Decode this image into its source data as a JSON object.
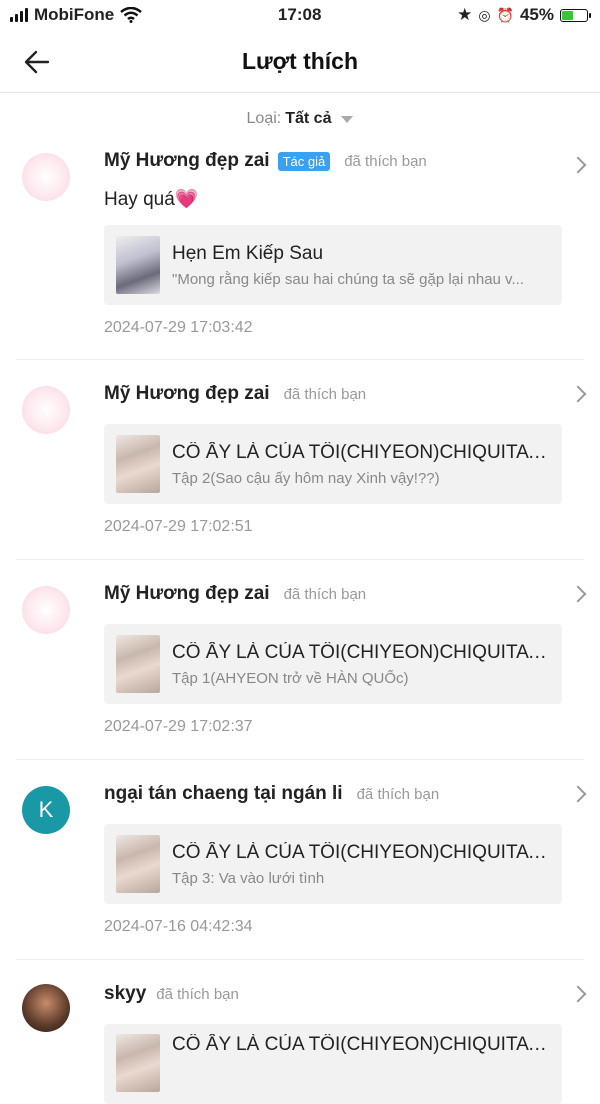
{
  "status": {
    "carrier": "MobiFone",
    "time": "17:08",
    "battery": "45%"
  },
  "header": {
    "title": "Lượt thích"
  },
  "filter": {
    "label": "Loại:",
    "value": "Tất cả"
  },
  "items": [
    {
      "name": "Mỹ Hương đẹp zai",
      "badge": "Tác giả",
      "action": "đã thích bạn",
      "comment": "Hay quá💗",
      "card_title": "Hẹn Em Kiếp Sau",
      "card_sub": "\"Mong rằng kiếp sau hai chúng ta sẽ gặp lại nhau v...",
      "time": "2024-07-29 17:03:42"
    },
    {
      "name": "Mỹ Hương đẹp zai",
      "action": "đã thích bạn",
      "card_title": "CÔ ẤY LÀ CỦA TÔI(CHIYEON)CHIQUITA V...",
      "card_sub": "Tập 2(Sao cậu ấy hôm nay Xinh vậy!??)",
      "time": "2024-07-29 17:02:51"
    },
    {
      "name": "Mỹ Hương đẹp zai",
      "action": "đã thích bạn",
      "card_title": "CÔ ẤY LÀ CỦA TÔI(CHIYEON)CHIQUITA V...",
      "card_sub": "Tập 1(AHYEON trở về HÀN QUỐc)",
      "time": "2024-07-29 17:02:37"
    },
    {
      "name": "ngại tán chaeng tại ngán li",
      "avatar_letter": "K",
      "action": "đã thích bạn",
      "card_title": "CÔ ẤY LÀ CỦA TÔI(CHIYEON)CHIQUITA V...",
      "card_sub": "Tập 3: Va vào lưới tình",
      "time": "2024-07-16 04:42:34"
    },
    {
      "name": "skyy",
      "action": "đã thích bạn",
      "card_title": "CÔ ẤY LÀ CỦA TÔI(CHIYEON)CHIQUITA V..."
    }
  ]
}
